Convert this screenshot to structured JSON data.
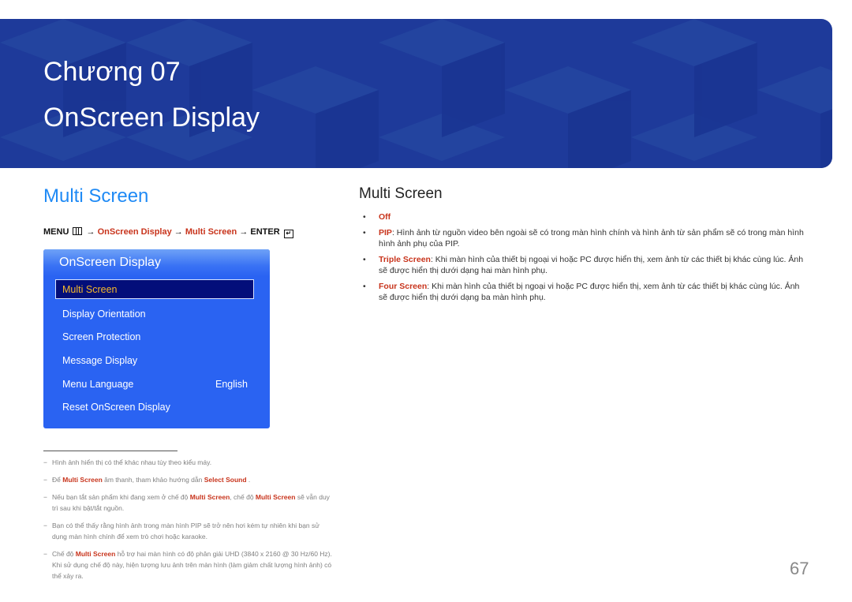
{
  "banner": {
    "chapter": "Chương 07",
    "title": "OnScreen Display",
    "color": "#1e3a9a"
  },
  "left": {
    "section_title": "Multi Screen",
    "menu_path": {
      "menu": "MENU",
      "arrow": "→",
      "step1": "OnScreen Display",
      "step2": "Multi Screen",
      "enter": "ENTER",
      "menu_icon": "menu-grid-icon",
      "enter_icon": "enter-icon"
    },
    "osd": {
      "header": "OnScreen Display",
      "selected": "Multi Screen",
      "items": [
        {
          "label": "Display Orientation"
        },
        {
          "label": "Screen Protection"
        },
        {
          "label": "Message Display"
        },
        {
          "label": "Menu Language",
          "value": "English"
        },
        {
          "label": "Reset OnScreen Display"
        }
      ]
    },
    "notes": [
      {
        "parts": [
          {
            "t": "Hình ảnh hiển thị có thể khác nhau tùy theo kiểu máy."
          }
        ]
      },
      {
        "parts": [
          {
            "t": "Để "
          },
          {
            "b": "Multi Screen"
          },
          {
            "t": " âm thanh, tham khảo hướng dẫn "
          },
          {
            "b": "Select Sound"
          },
          {
            "t": " ."
          }
        ]
      },
      {
        "parts": [
          {
            "t": "Nếu bạn tắt sản phẩm khi đang xem ở chế độ "
          },
          {
            "b": "Multi Screen"
          },
          {
            "t": ", chế độ "
          },
          {
            "b": "Multi Screen"
          },
          {
            "t": " sẽ vẫn duy trì sau khi bật/tắt nguồn."
          }
        ]
      },
      {
        "parts": [
          {
            "t": "Bạn có thể thấy rằng hình ảnh trong màn hình PIP sẽ trở nên hơi kém tự nhiên khi bạn sử dụng màn hình chính để xem trò chơi hoặc karaoke."
          }
        ]
      },
      {
        "parts": [
          {
            "t": "Chế độ "
          },
          {
            "b": "Multi Screen"
          },
          {
            "t": " hỗ trợ hai màn hình có độ phân giải UHD (3840 x 2160 @ 30 Hz/60 Hz). Khi sử dụng chế độ này, hiện tượng lưu ảnh trên màn hình (làm giảm chất lượng hình ảnh) có thể xảy ra."
          }
        ]
      }
    ]
  },
  "right": {
    "title": "Multi Screen",
    "bullets": [
      {
        "term": "Off",
        "text": ""
      },
      {
        "term": "PIP",
        "text": ": Hình ảnh từ nguồn video bên ngoài sẽ có trong màn hình chính và hình ảnh từ sản phẩm sẽ có trong màn hình hình ảnh phụ của PIP."
      },
      {
        "term": "Triple Screen",
        "text": ": Khi màn hình của thiết bị ngoại vi hoặc PC được hiển thị, xem ảnh từ các thiết bị khác cùng lúc. Ảnh sẽ được hiển thị dưới dạng hai màn hình phụ."
      },
      {
        "term": "Four Screen",
        "text": ": Khi màn hình của thiết bị ngoại vi hoặc PC được hiển thị, xem ảnh từ các thiết bị khác cùng lúc. Ảnh sẽ được hiển thị dưới dạng ba màn hình phụ."
      }
    ]
  },
  "page_number": "67",
  "colors": {
    "accent_blue": "#1f8af5",
    "highlight_red": "#c8341c",
    "osd_blue": "#2a63f2",
    "osd_selected_bg": "#030e7a",
    "osd_selected_text": "#f5b82a"
  }
}
